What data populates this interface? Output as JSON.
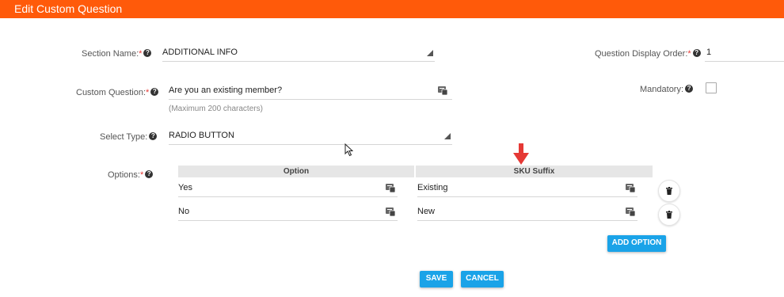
{
  "header": {
    "title": "Edit Custom Question"
  },
  "form": {
    "section_name": {
      "label": "Section Name:",
      "required": "*",
      "value": "ADDITIONAL INFO"
    },
    "display_order": {
      "label": "Question Display Order:",
      "required": "*",
      "value": "1"
    },
    "custom_question": {
      "label": "Custom Question:",
      "required": "*",
      "value": "Are you an existing member?",
      "hint": "(Maximum 200 characters)"
    },
    "mandatory": {
      "label": "Mandatory:",
      "checked": false
    },
    "select_type": {
      "label": "Select Type:",
      "value": "RADIO BUTTON"
    },
    "options": {
      "label": "Options:",
      "required": "*",
      "columns": [
        "Option",
        "SKU Suffix"
      ],
      "rows": [
        {
          "option": "Yes",
          "sku_suffix": "Existing"
        },
        {
          "option": "No",
          "sku_suffix": "New"
        }
      ],
      "add_label": "ADD OPTION"
    }
  },
  "actions": {
    "save_label": "SAVE",
    "cancel_label": "CANCEL"
  },
  "help_glyph": "?",
  "icons": [
    "help-icon",
    "language-tag-icon",
    "dropdown-caret-icon",
    "trash-icon",
    "red-arrow-icon",
    "mouse-cursor-icon"
  ],
  "colors": {
    "header": "#ff5a0a",
    "primary_button": "#1aa3e8",
    "required": "#e53935",
    "arrow": "#e53935"
  }
}
